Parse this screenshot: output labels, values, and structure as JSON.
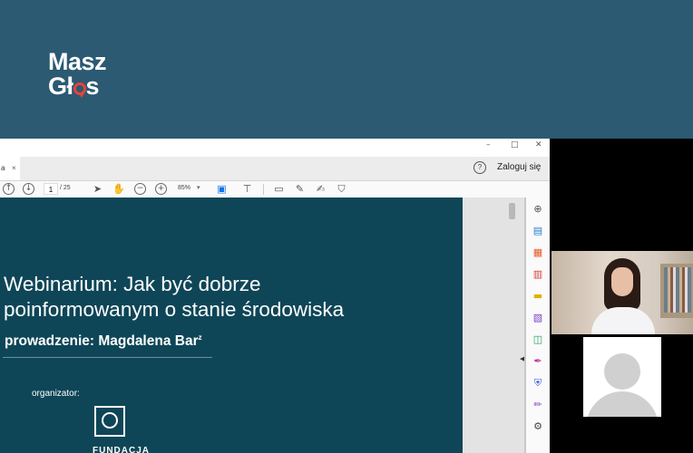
{
  "banner": {
    "logo_line1": "Masz",
    "logo_line2_prefix": "Gł",
    "logo_line2_suffix": "s",
    "accent_color": "#e8423b",
    "background_color": "#2b5a72"
  },
  "window": {
    "controls": {
      "minimize": "–",
      "restore": "□",
      "close": "✕"
    }
  },
  "tabs": [
    {
      "label": "a",
      "close": "×"
    }
  ],
  "header": {
    "help_icon": "?",
    "login_label": "Zaloguj się"
  },
  "toolbar": {
    "page_current": "1",
    "page_total": "/ 25",
    "zoom": "85%",
    "zoom_caret": "▾",
    "icons": [
      "page-up-icon",
      "page-down-icon",
      "select-cursor-icon",
      "hand-icon",
      "zoom-out-icon",
      "zoom-in-icon",
      "fit-page-icon",
      "scroll-mode-icon",
      "comment-icon",
      "highlight-icon",
      "sign-icon",
      "stamp-icon"
    ]
  },
  "slide": {
    "title_line1": "Webinarium: Jak być dobrze",
    "title_line2": "poinformowanym o stanie środowiska",
    "presenter": "prowadzenie: Magdalena Bar",
    "presenter_mark": "z",
    "organizer_label": "organizator:",
    "organizer_name": "FUNDACJA",
    "background_color": "#0e4657"
  },
  "right_tools": {
    "icons": [
      "search-zoom-icon",
      "export-pdf-icon",
      "organize-pages-icon",
      "create-pdf-icon",
      "comment-tool-icon",
      "combine-files-icon",
      "compress-icon",
      "fill-sign-icon",
      "protect-icon",
      "edit-pdf-icon",
      "more-tools-icon"
    ]
  },
  "participants": [
    {
      "type": "video"
    },
    {
      "type": "placeholder"
    }
  ]
}
